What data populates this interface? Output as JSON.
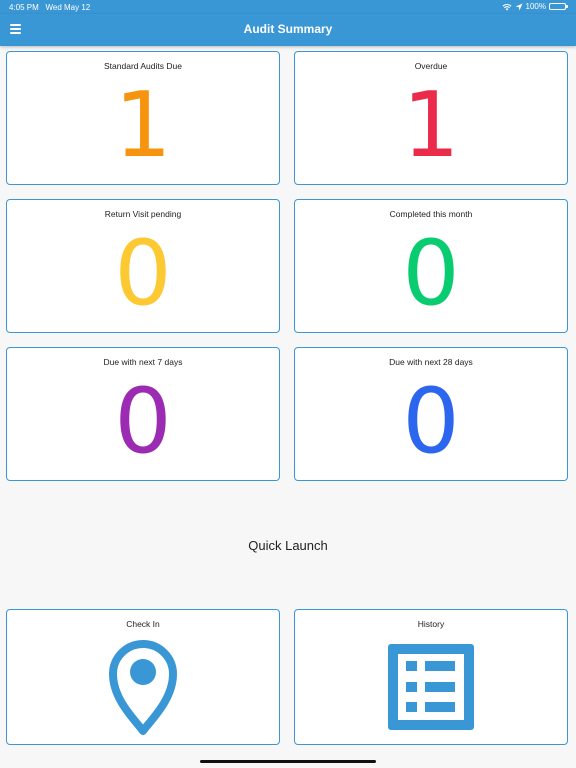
{
  "status_bar": {
    "time": "4:05 PM",
    "date": "Wed May 12",
    "battery": "100%",
    "battery_level": 1.0
  },
  "app_bar": {
    "title": "Audit Summary",
    "menu_icon": "hamburger-menu-icon"
  },
  "summary": [
    {
      "label": "Standard Audits Due",
      "value": "1",
      "color": "#f7940f"
    },
    {
      "label": "Overdue",
      "value": "1",
      "color": "#ea2b4a"
    },
    {
      "label": "Return Visit pending",
      "value": "0",
      "color": "#fcc933"
    },
    {
      "label": "Completed this month",
      "value": "0",
      "color": "#09cc71"
    },
    {
      "label": "Due with next 7 days",
      "value": "0",
      "color": "#9b2bb3"
    },
    {
      "label": "Due with next 28 days",
      "value": "0",
      "color": "#2d66ee"
    }
  ],
  "quick_launch": {
    "title": "Quick Launch",
    "items": [
      {
        "label": "Check In",
        "icon": "map-pin-icon"
      },
      {
        "label": "History",
        "icon": "list-document-icon"
      }
    ]
  },
  "colors": {
    "accent": "#3a97d6",
    "background": "#f7f7f7"
  }
}
